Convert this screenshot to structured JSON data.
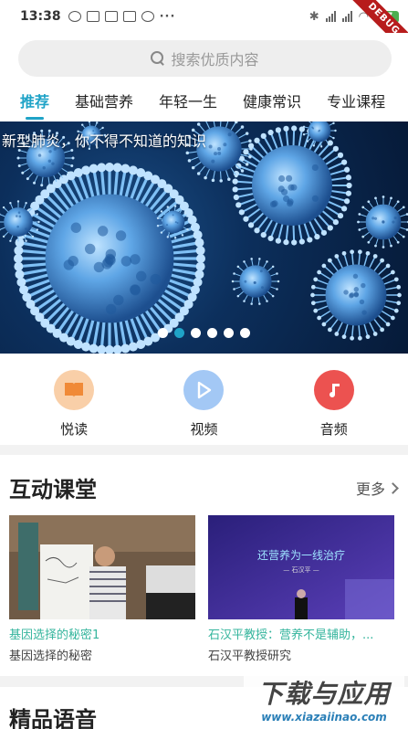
{
  "status_bar": {
    "time": "13:38",
    "battery": "57",
    "debug_label": "DEBUG",
    "more_dots": "···"
  },
  "search": {
    "placeholder": "搜索优质内容",
    "icon": "search-icon"
  },
  "tabs": [
    {
      "label": "推荐",
      "active": true
    },
    {
      "label": "基础营养",
      "active": false
    },
    {
      "label": "年轻一生",
      "active": false
    },
    {
      "label": "健康常识",
      "active": false
    },
    {
      "label": "专业课程",
      "active": false
    }
  ],
  "banner": {
    "title": "新型肺炎，你不得不知道的知识",
    "dot_count": 6,
    "active_dot": 1
  },
  "quick_links": [
    {
      "label": "悦读",
      "icon": "book-icon",
      "color": "#f6c89f"
    },
    {
      "label": "视频",
      "icon": "play-icon",
      "color": "#9cc5f7"
    },
    {
      "label": "音频",
      "icon": "music-note-icon",
      "color": "#ef5350"
    }
  ],
  "interactive_class": {
    "title": "互动课堂",
    "more_label": "更多",
    "cards": [
      {
        "title": "基因选择的秘密1",
        "subtitle": "基因选择的秘密"
      },
      {
        "title": "石汉平教授：营养不是辅助，...",
        "subtitle": "石汉平教授研究",
        "thumb_caption": "还营养为一线治疗",
        "thumb_sub": "— 石汉平 —"
      }
    ]
  },
  "premium_audio": {
    "title": "精品语音"
  },
  "watermark": {
    "text": "下载与应用",
    "url": "www.xiazaiinao.com"
  },
  "colors": {
    "accent": "#1fa3c7",
    "card_title": "#35b59d"
  }
}
